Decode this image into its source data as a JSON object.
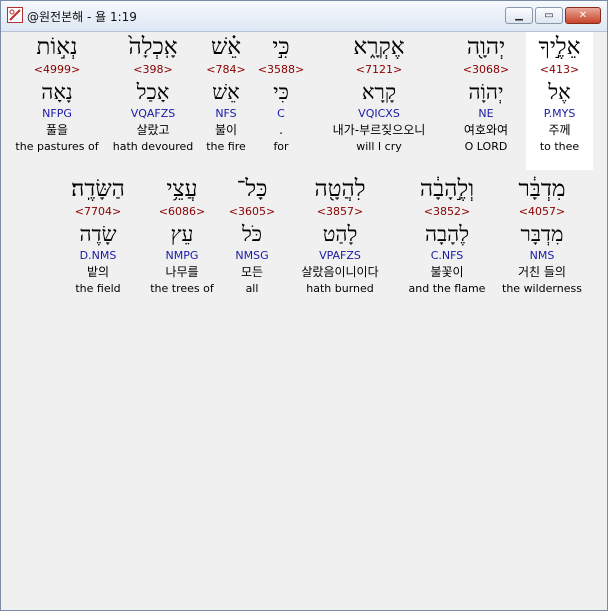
{
  "window": {
    "title": "@원전본해 - 욜 1:19",
    "minimize_icon": "minimize-icon",
    "maximize_icon": "maximize-icon",
    "close_icon": "close-icon",
    "minimize_label": "▁",
    "maximize_label": "▭",
    "close_label": "✕"
  },
  "verse": {
    "row1": [
      {
        "hebrew": "אֵלֶ֣יךָ",
        "strongs": "<413>",
        "lemma": "אֶל",
        "parsing": "P.MYS",
        "korean": "주께",
        "english": "to thee",
        "highlighted": true
      },
      {
        "hebrew": "יְהוָ֖ה",
        "strongs": "<3068>",
        "lemma": "יְהוָֹה",
        "parsing": "NE",
        "korean": "여호와여",
        "english": "O LORD"
      },
      {
        "hebrew": "אֶקְרָ֑א",
        "strongs": "<7121>",
        "lemma": "קָרָא",
        "parsing": "VQICXS",
        "korean": "내가-부르짖으오니",
        "english": "will I cry"
      },
      {
        "hebrew": "כִּ֣י",
        "strongs": "<3588>",
        "lemma": "כִּי",
        "parsing": "C",
        "korean": ".",
        "english": "for"
      },
      {
        "hebrew": "אֵ֗שׁ",
        "strongs": "<784>",
        "lemma": "אֵשׁ",
        "parsing": "NFS",
        "korean": "불이",
        "english": "the fire"
      },
      {
        "hebrew": "אָֽכְלָה֙",
        "strongs": "<398>",
        "lemma": "אָכַל",
        "parsing": "VQAFZS",
        "korean": "살랐고",
        "english": "hath devoured"
      },
      {
        "hebrew": "נְא֣וֹת",
        "strongs": "<4999>",
        "lemma": "נָאָה",
        "parsing": "NFPG",
        "korean": "풀을",
        "english": "the pastures of"
      }
    ],
    "row2": [
      {
        "hebrew": "מִדְבָּ֔ר",
        "strongs": "<4057>",
        "lemma": "מִדְבָּר",
        "parsing": "NMS",
        "korean": "거친 들의",
        "english": "the wilderness"
      },
      {
        "hebrew": "וְלֶ֣הָבָ֔ה",
        "strongs": "<3852>",
        "lemma": "לֶהָבָה",
        "parsing": "C.NFS",
        "korean": "불꽃이",
        "english": "and the flame"
      },
      {
        "hebrew": "לִהֲטָ֖ה",
        "strongs": "<3857>",
        "lemma": "לָהַט",
        "parsing": "VPAFZS",
        "korean": "살랐음이니이다",
        "english": "hath burned"
      },
      {
        "hebrew": "כָּל־",
        "strongs": "<3605>",
        "lemma": "כֹּל",
        "parsing": "NMSG",
        "korean": "모든",
        "english": "all"
      },
      {
        "hebrew": "עֲצֵ֥י",
        "strongs": "<6086>",
        "lemma": "עֵץ",
        "parsing": "NMPG",
        "korean": "나무를",
        "english": "the trees of"
      },
      {
        "hebrew": "הַשָּׂדֶֽה׃",
        "strongs": "<7704>",
        "lemma": "שָׂדֶה",
        "parsing": "D.NMS",
        "korean": "밭의",
        "english": "the field"
      }
    ]
  }
}
